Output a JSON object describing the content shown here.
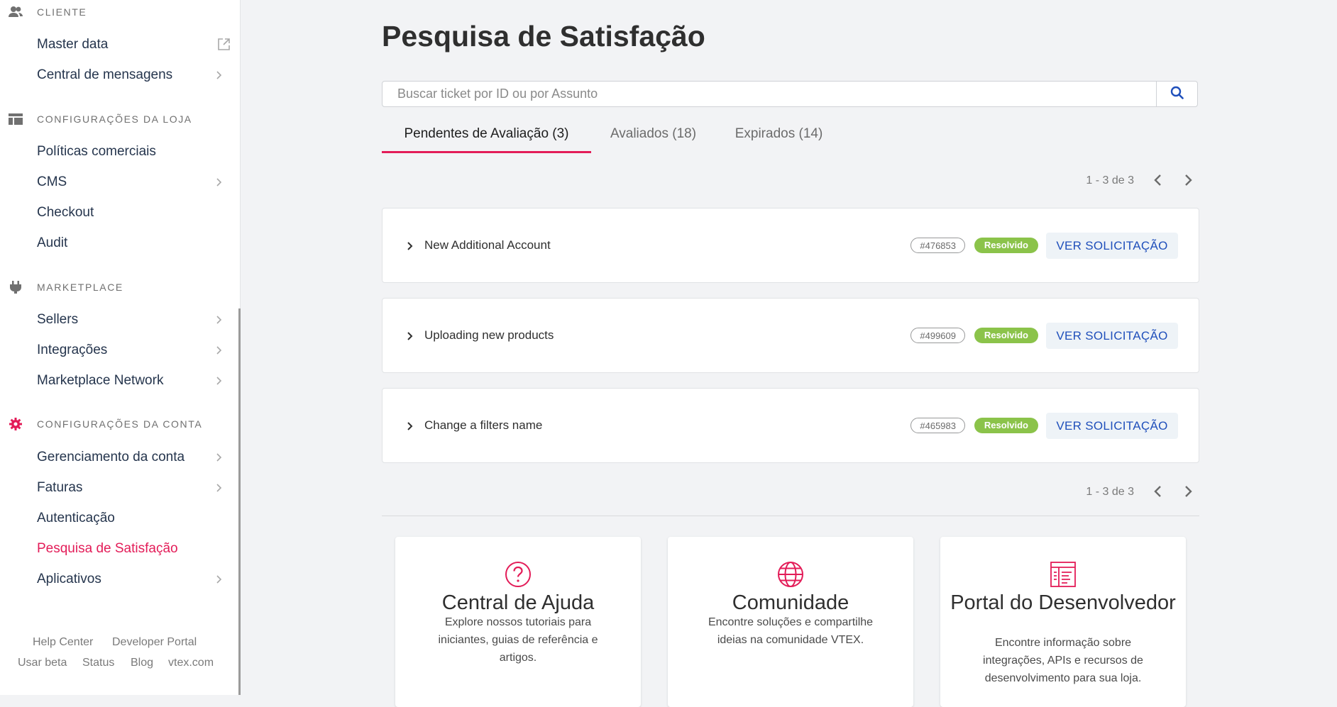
{
  "sidebar": {
    "sections": [
      {
        "label": "CLIENTE",
        "icon": "users-icon",
        "items": [
          {
            "label": "Master data",
            "trailing": "external-link"
          },
          {
            "label": "Central de mensagens",
            "trailing": "chevron"
          }
        ]
      },
      {
        "label": "CONFIGURAÇÕES DA LOJA",
        "icon": "layout-icon",
        "items": [
          {
            "label": "Políticas comerciais",
            "trailing": "none"
          },
          {
            "label": "CMS",
            "trailing": "chevron"
          },
          {
            "label": "Checkout",
            "trailing": "none"
          },
          {
            "label": "Audit",
            "trailing": "none"
          }
        ]
      },
      {
        "label": "MARKETPLACE",
        "icon": "plug-icon",
        "items": [
          {
            "label": "Sellers",
            "trailing": "chevron"
          },
          {
            "label": "Integrações",
            "trailing": "chevron"
          },
          {
            "label": "Marketplace Network",
            "trailing": "chevron"
          }
        ]
      },
      {
        "label": "CONFIGURAÇÕES DA CONTA",
        "icon": "gear-icon",
        "items": [
          {
            "label": "Gerenciamento da conta",
            "trailing": "chevron"
          },
          {
            "label": "Faturas",
            "trailing": "chevron"
          },
          {
            "label": "Autenticação",
            "trailing": "none"
          },
          {
            "label": "Pesquisa de Satisfação",
            "trailing": "none",
            "active": true
          },
          {
            "label": "Aplicativos",
            "trailing": "chevron"
          }
        ]
      }
    ],
    "footer": {
      "help_center": "Help Center",
      "developer_portal": "Developer Portal",
      "use_beta": "Usar beta",
      "status": "Status",
      "blog": "Blog",
      "site": "vtex.com"
    }
  },
  "main": {
    "title": "Pesquisa de Satisfação",
    "search": {
      "placeholder": "Buscar ticket por ID ou por Assunto",
      "value": ""
    },
    "tabs": [
      {
        "label": "Pendentes de Avaliação (3)",
        "active": true
      },
      {
        "label": "Avaliados (18)",
        "active": false
      },
      {
        "label": "Expirados (14)",
        "active": false
      }
    ],
    "pagination": {
      "label": "1 - 3 de 3"
    },
    "tickets": [
      {
        "title": "New Additional Account",
        "id": "#476853",
        "status": "Resolvido",
        "action": "VER SOLICITAÇÃO"
      },
      {
        "title": "Uploading new products",
        "id": "#499609",
        "status": "Resolvido",
        "action": "VER SOLICITAÇÃO"
      },
      {
        "title": "Change a filters name",
        "id": "#465983",
        "status": "Resolvido",
        "action": "VER SOLICITAÇÃO"
      }
    ],
    "help_cards": [
      {
        "icon": "question-circle-icon",
        "title": "Central de Ajuda",
        "description": "Explore nossos tutoriais para iniciantes, guias de referência e artigos."
      },
      {
        "icon": "globe-icon",
        "title": "Comunidade",
        "description": "Encontre soluções e compartilhe ideias na comunidade VTEX."
      },
      {
        "icon": "developer-doc-icon",
        "title": "Portal do Desenvolvedor",
        "description": "Encontre informação sobre integrações, APIs e recursos de desenvolvimento para sua loja."
      }
    ]
  },
  "colors": {
    "accent": "#e31c58",
    "status_green": "#8bc34a",
    "link_blue": "#1f4fbb",
    "background": "#f2f3f5"
  }
}
